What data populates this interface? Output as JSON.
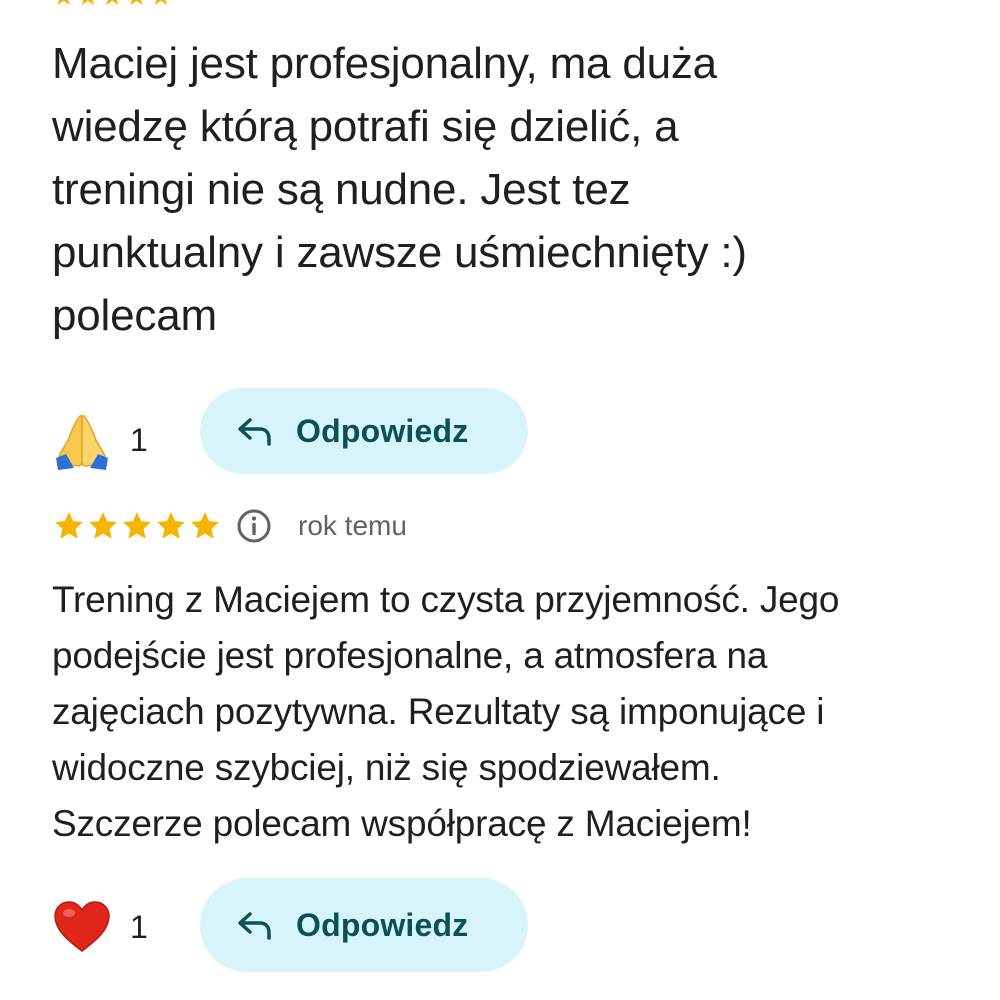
{
  "reviews": [
    {
      "text": "Maciej jest profesjonalny, ma duża\nwiedzę którą potrafi się dzielić, a\ntreningi nie są nudne. Jest tez\npunktualny i zawsze uśmiechnięty :)\npolecam",
      "reaction": {
        "icon": "folded-hands",
        "count": "1"
      },
      "reply_label": "Odpowiedz"
    },
    {
      "rating": 5,
      "time": "rok temu",
      "text": "Trening z Maciejem to czysta przyjemność. Jego\npodejście jest profesjonalne, a atmosfera na\nzajęciach pozytywna. Rezultaty są imponujące i\nwidoczne szybciej, niż się spodziewałem.\nSzczerze polecam współpracę z Maciejem!",
      "reaction": {
        "icon": "red-heart",
        "count": "1"
      },
      "reply_label": "Odpowiedz"
    }
  ],
  "colors": {
    "star": "#f4b400",
    "reply_bg": "#d8f4fb",
    "reply_text": "#0b4f57",
    "muted": "#5f6368"
  }
}
